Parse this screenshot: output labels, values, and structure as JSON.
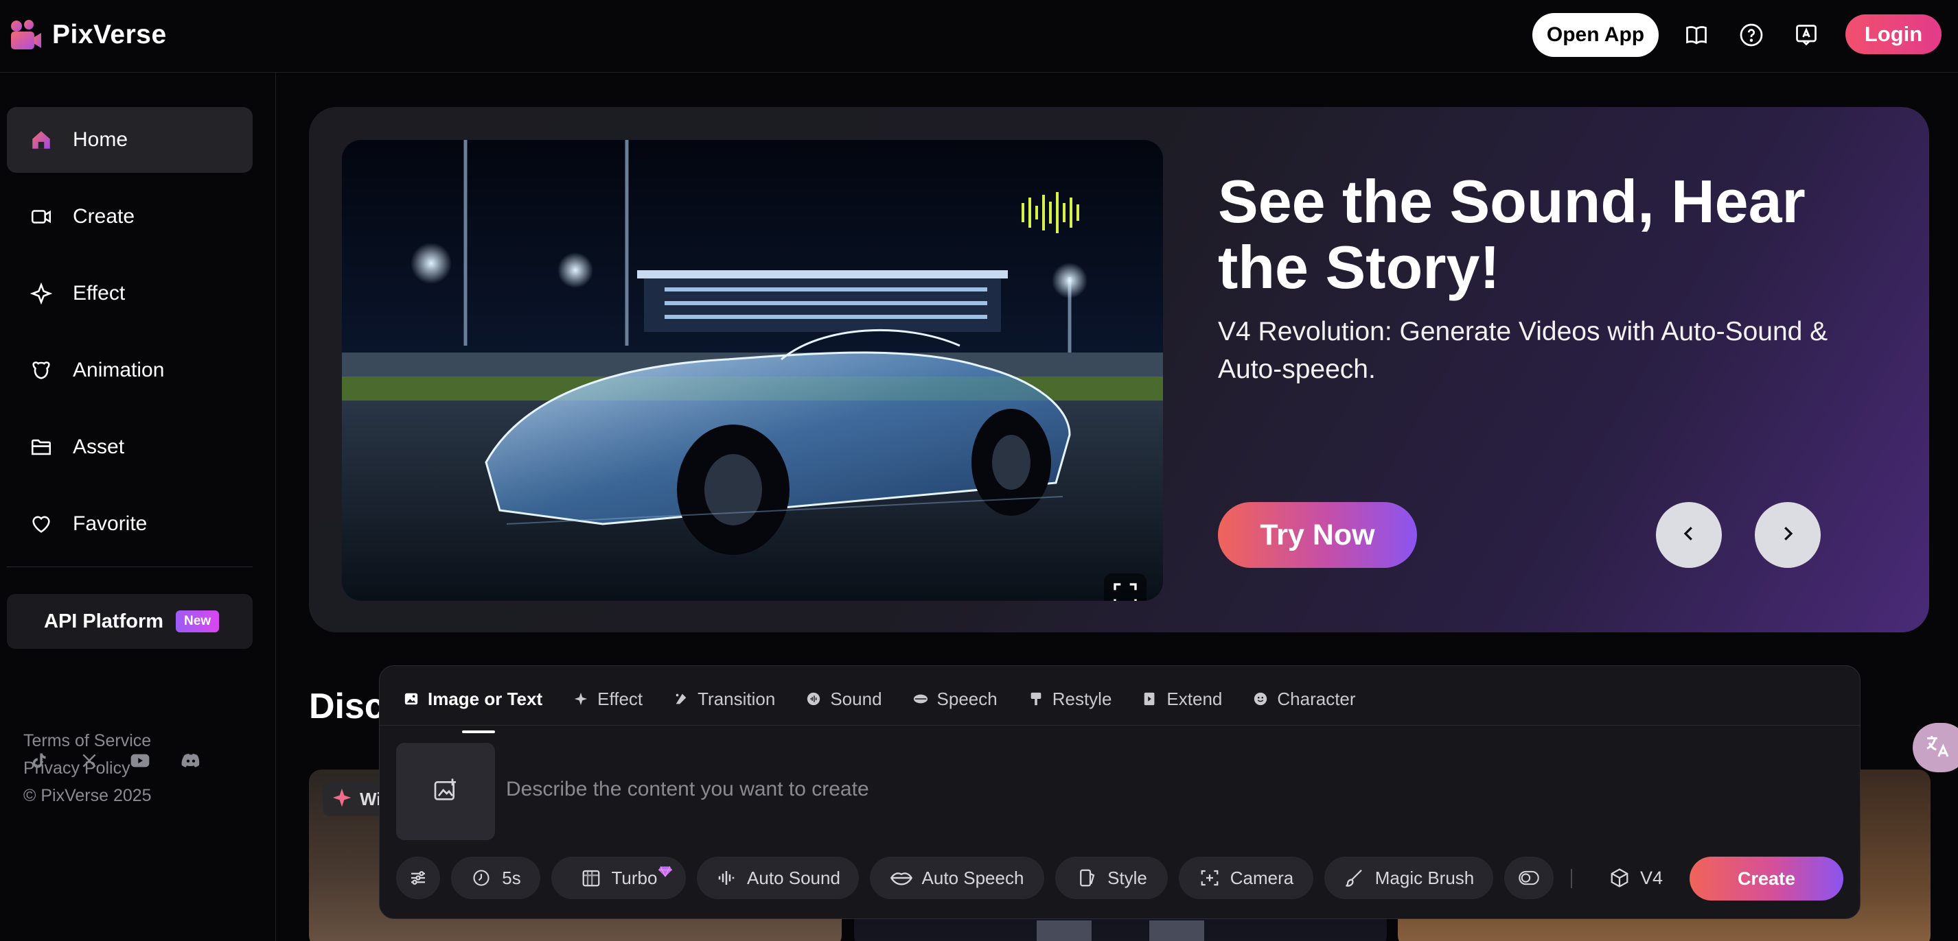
{
  "app": {
    "name": "PixVerse",
    "brand_colors": {
      "accent_pink": "#f0506e",
      "accent_purple": "#8b55f0",
      "accent_orange": "#f0645a"
    }
  },
  "header": {
    "open_app_label": "Open App",
    "login_label": "Login",
    "icons": [
      "book-icon",
      "help-icon",
      "feedback-icon"
    ]
  },
  "sidebar": {
    "items": [
      {
        "label": "Home",
        "icon": "home-icon",
        "active": true
      },
      {
        "label": "Create",
        "icon": "video-camera-icon",
        "active": false
      },
      {
        "label": "Effect",
        "icon": "sparkle-icon",
        "active": false
      },
      {
        "label": "Animation",
        "icon": "animation-icon",
        "active": false
      },
      {
        "label": "Asset",
        "icon": "folder-icon",
        "active": false
      },
      {
        "label": "Favorite",
        "icon": "heart-icon",
        "active": false
      }
    ],
    "api_platform": {
      "label": "API Platform",
      "badge": "New"
    },
    "socials": [
      "tiktok-icon",
      "x-icon",
      "youtube-icon",
      "discord-icon"
    ],
    "footer": {
      "terms": "Terms of Service",
      "privacy": "Privacy Policy",
      "copyright": "© PixVerse 2025"
    }
  },
  "hero": {
    "title": "See the Sound, Hear the Story!",
    "subtitle": "V4 Revolution: Generate Videos with Auto-Sound & Auto-speech.",
    "cta_label": "Try Now"
  },
  "discover": {
    "title_visible": "Disc",
    "card_badge_visible": "Wi"
  },
  "composer": {
    "tabs": [
      {
        "label": "Image or Text",
        "icon": "image-icon",
        "active": true
      },
      {
        "label": "Effect",
        "icon": "sparkle-icon",
        "active": false
      },
      {
        "label": "Transition",
        "icon": "transition-icon",
        "active": false
      },
      {
        "label": "Sound",
        "icon": "sound-icon",
        "active": false
      },
      {
        "label": "Speech",
        "icon": "speech-icon",
        "active": false
      },
      {
        "label": "Restyle",
        "icon": "brush-icon",
        "active": false
      },
      {
        "label": "Extend",
        "icon": "extend-icon",
        "active": false
      },
      {
        "label": "Character",
        "icon": "character-icon",
        "active": false
      }
    ],
    "prompt_placeholder": "Describe the content you want to create",
    "chips": {
      "duration": "5s",
      "turbo": "Turbo",
      "auto_sound": "Auto Sound",
      "auto_speech": "Auto Speech",
      "style": "Style",
      "camera": "Camera",
      "magic_brush": "Magic Brush"
    },
    "model": "V4",
    "create_label": "Create"
  }
}
